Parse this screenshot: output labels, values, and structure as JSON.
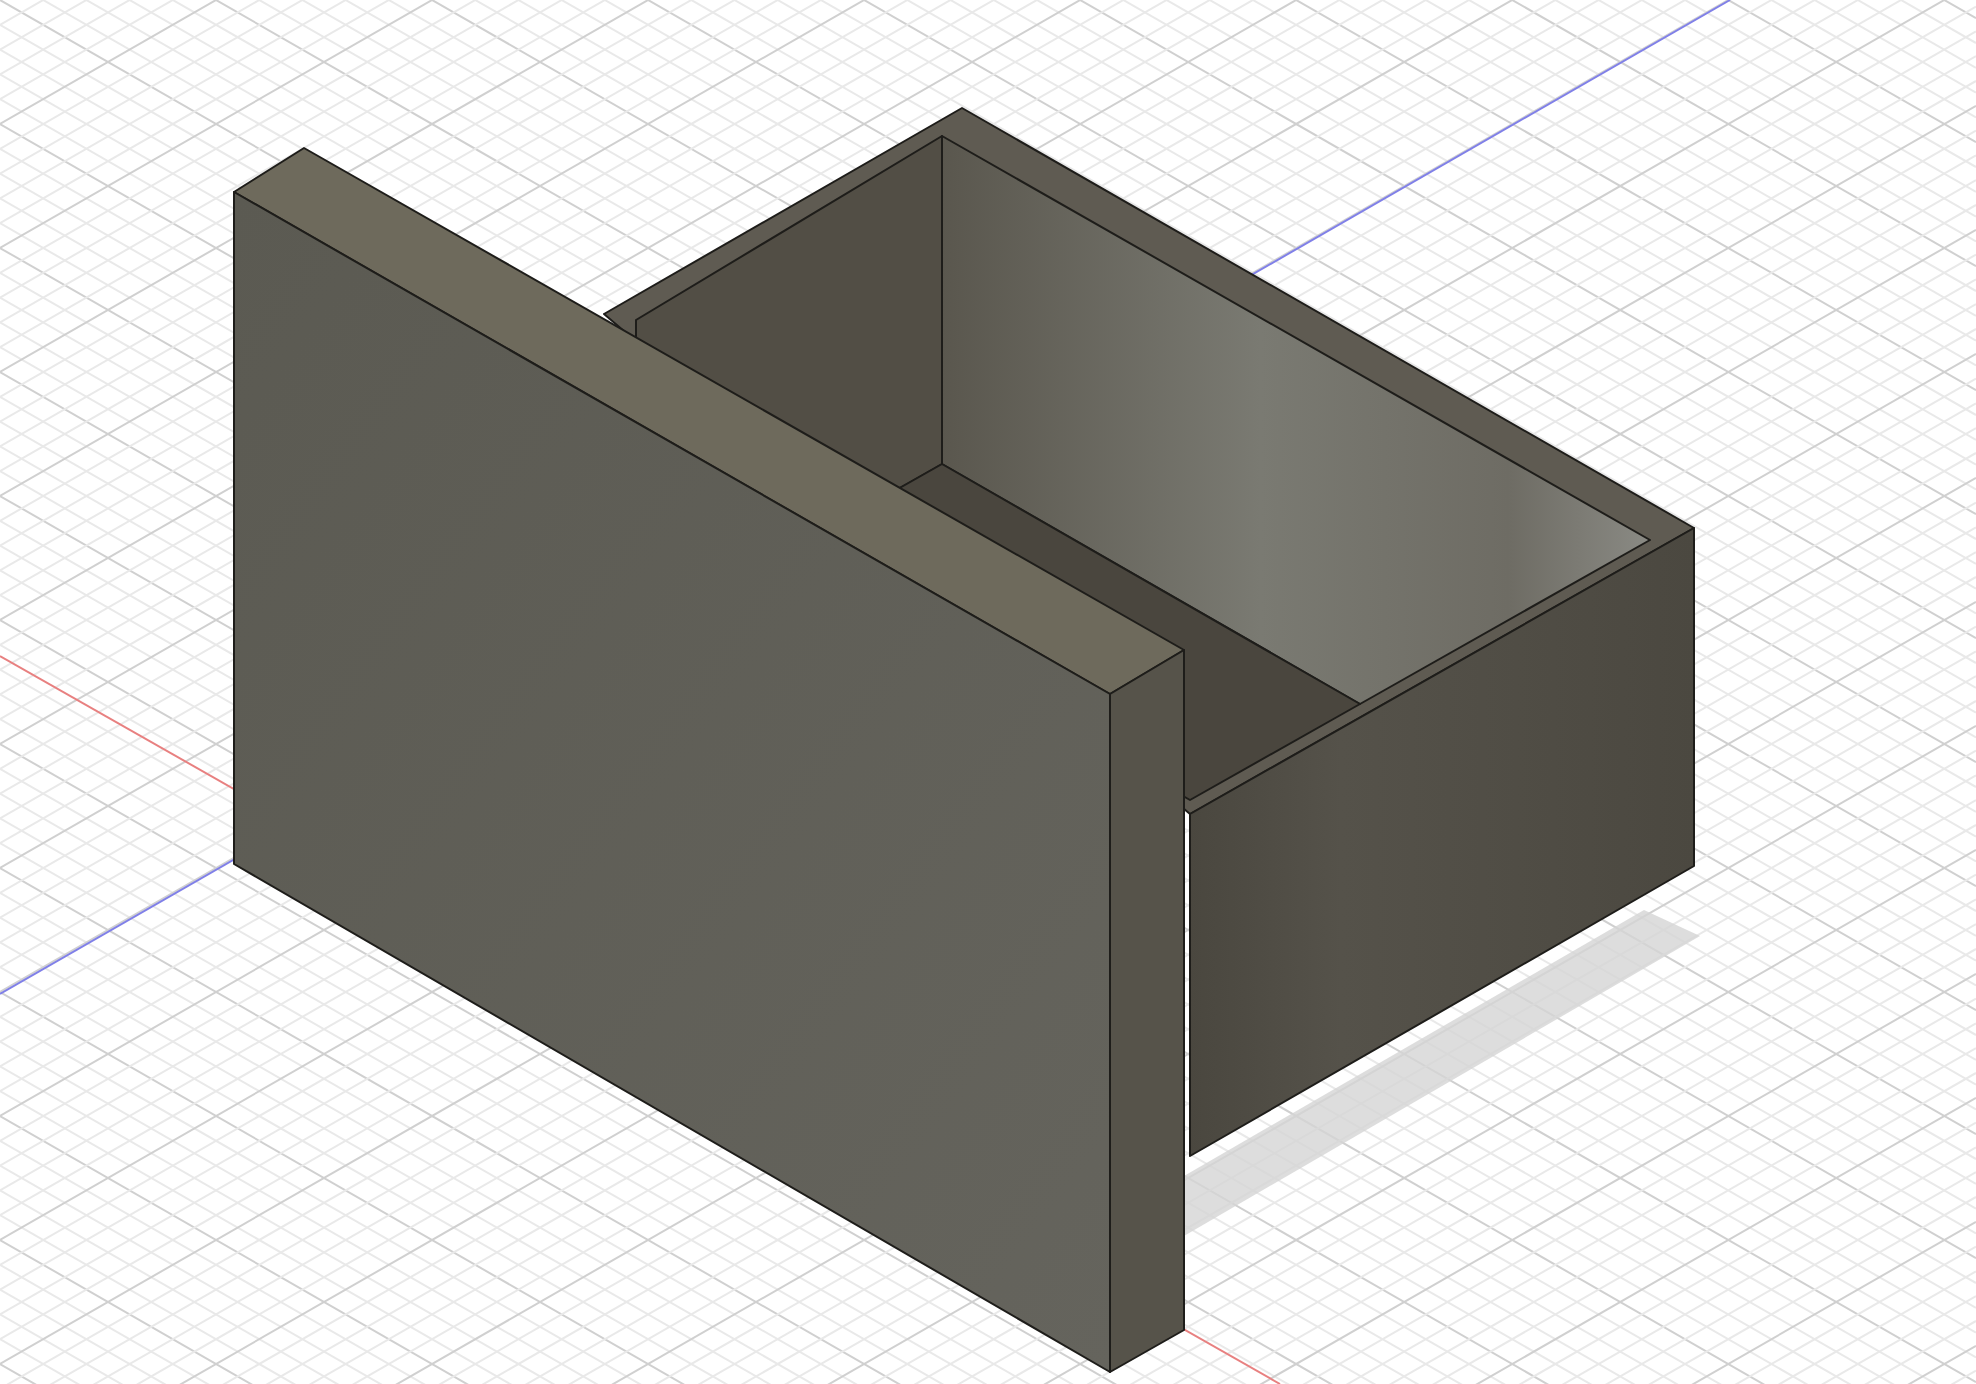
{
  "viewport": {
    "model": {
      "kind": "drawer"
    }
  }
}
